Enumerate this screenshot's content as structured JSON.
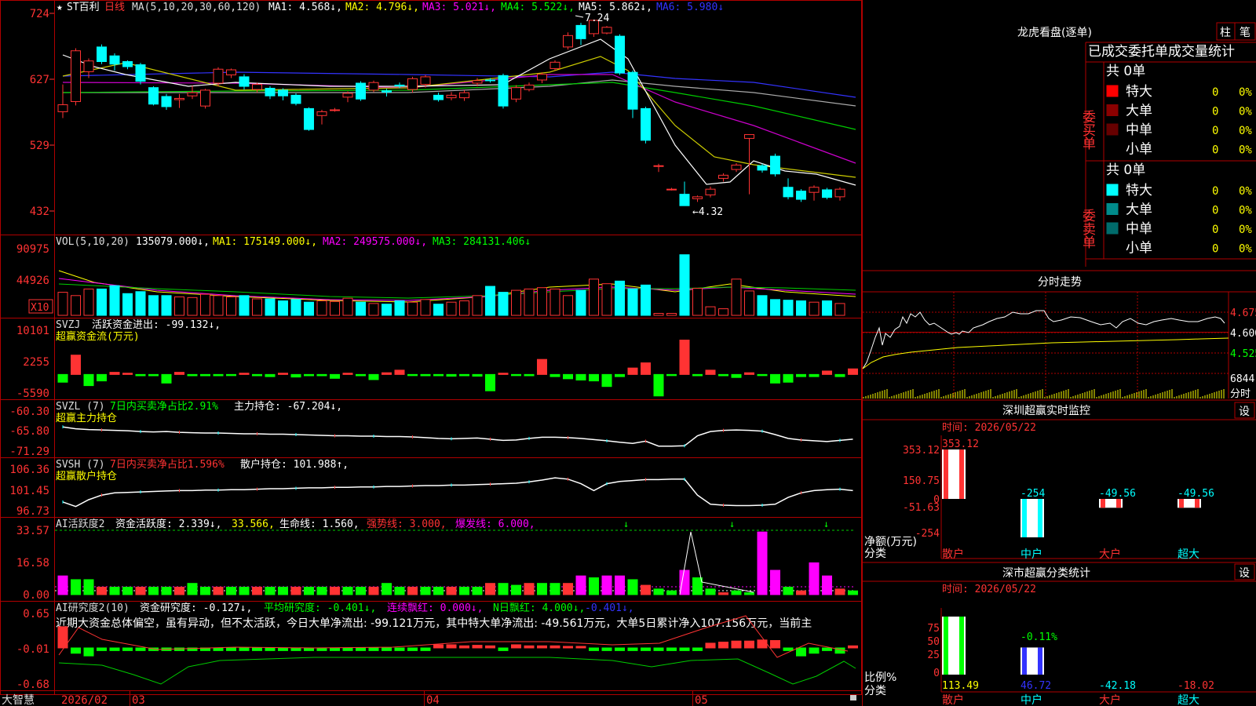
{
  "app": {
    "name": "大智慧"
  },
  "colors": {
    "red": "#ff3333",
    "cyan": "#00ffff",
    "magenta": "#ff00ff",
    "green": "#00ff00",
    "yellow": "#ffff00",
    "white": "#ffffff",
    "blue": "#3333ff",
    "dark_green": "#2e8b57",
    "frame": "#b00000"
  },
  "kline": {
    "header": {
      "star": "★",
      "stock": "ST百利",
      "period": "日线",
      "ma_label": "MA(5,10,20,30,60,120)",
      "items": [
        {
          "label": "MA1: 4.568↓,",
          "color": "white"
        },
        {
          "label": "MA2: 4.796↓,",
          "color": "yellow"
        },
        {
          "label": "MA3: 5.021↓,",
          "color": "magenta"
        },
        {
          "label": "MA4: 5.522↓,",
          "color": "green"
        },
        {
          "label": "MA5: 5.862↓,",
          "color": "white"
        },
        {
          "label": "MA6: 5.980↓",
          "color": "blue"
        }
      ]
    },
    "y_labels": [
      "724",
      "627",
      "529",
      "432"
    ],
    "high_annotation": "7.24",
    "low_annotation": "←4.32"
  },
  "chart_data": [
    {
      "type": "candlestick",
      "id": "price",
      "ylim": [
        4.1,
        7.35
      ],
      "x_labels": [
        "2026/02",
        "03",
        "04",
        "05"
      ],
      "candles": [
        [
          5.8,
          5.91,
          5.7,
          6.23
        ],
        [
          5.96,
          6.76,
          5.9,
          6.8
        ],
        [
          6.43,
          6.6,
          6.33,
          6.64
        ],
        [
          6.82,
          6.59,
          6.55,
          6.86
        ],
        [
          6.68,
          6.55,
          6.45,
          6.72
        ],
        [
          6.59,
          6.51,
          6.47,
          6.61
        ],
        [
          6.54,
          6.28,
          6.23,
          6.57
        ],
        [
          6.18,
          5.92,
          5.9,
          6.2
        ],
        [
          6.04,
          5.88,
          5.83,
          6.08
        ],
        [
          5.99,
          6.01,
          5.86,
          6.08
        ],
        [
          6.05,
          6.1,
          6.0,
          6.21
        ],
        [
          5.89,
          6.14,
          5.85,
          6.16
        ],
        [
          6.25,
          6.47,
          6.2,
          6.5
        ],
        [
          6.38,
          6.46,
          6.33,
          6.48
        ],
        [
          6.35,
          6.2,
          6.15,
          6.39
        ],
        [
          6.15,
          6.23,
          6.1,
          6.26
        ],
        [
          6.17,
          6.05,
          6.0,
          6.2
        ],
        [
          6.14,
          6.05,
          5.98,
          6.17
        ],
        [
          6.06,
          5.93,
          5.9,
          6.09
        ],
        [
          5.85,
          5.52,
          5.5,
          5.87
        ],
        [
          5.74,
          5.8,
          5.6,
          5.83
        ],
        [
          5.83,
          5.83,
          5.8,
          5.86
        ],
        [
          6.03,
          6.09,
          5.95,
          6.12
        ],
        [
          6.25,
          6.0,
          5.97,
          6.28
        ],
        [
          6.14,
          6.26,
          6.11,
          6.29
        ],
        [
          6.13,
          6.11,
          6.04,
          6.16
        ],
        [
          6.22,
          6.21,
          6.17,
          6.26
        ],
        [
          6.15,
          6.32,
          6.1,
          6.35
        ],
        [
          6.23,
          6.35,
          6.18,
          6.38
        ],
        [
          6.06,
          5.99,
          5.96,
          6.1
        ],
        [
          6.02,
          6.06,
          5.98,
          6.11
        ],
        [
          6.02,
          6.1,
          5.97,
          6.14
        ],
        [
          6.25,
          6.29,
          6.2,
          6.33
        ],
        [
          6.3,
          6.29,
          6.26,
          6.33
        ],
        [
          6.37,
          5.89,
          5.85,
          6.4
        ],
        [
          6.0,
          6.18,
          5.95,
          6.22
        ],
        [
          6.15,
          6.22,
          6.12,
          6.26
        ],
        [
          6.3,
          6.39,
          6.25,
          6.42
        ],
        [
          6.48,
          6.58,
          6.45,
          6.61
        ],
        [
          6.82,
          7.0,
          6.78,
          7.05
        ],
        [
          7.16,
          6.95,
          6.85,
          7.2
        ],
        [
          7.03,
          7.24,
          6.98,
          7.24
        ],
        [
          7.04,
          7.13,
          7.02,
          7.15
        ],
        [
          6.99,
          6.41,
          6.38,
          7.02
        ],
        [
          6.42,
          5.84,
          5.7,
          6.45
        ],
        [
          5.85,
          5.35,
          5.3,
          5.88
        ],
        [
          4.95,
          4.95,
          4.85,
          4.98
        ],
        [
          4.58,
          4.58,
          4.56,
          4.6
        ],
        [
          4.5,
          4.32,
          4.32,
          4.7
        ],
        [
          4.43,
          4.46,
          4.38,
          4.48
        ],
        [
          4.49,
          4.58,
          4.45,
          4.62
        ],
        [
          4.75,
          4.8,
          4.7,
          4.83
        ],
        [
          4.89,
          4.96,
          4.85,
          4.99
        ],
        [
          5.38,
          5.44,
          4.5,
          5.44
        ],
        [
          4.95,
          4.88,
          4.84,
          4.98
        ],
        [
          5.1,
          4.82,
          4.78,
          5.14
        ],
        [
          4.61,
          4.46,
          4.42,
          4.75
        ],
        [
          4.55,
          4.42,
          4.38,
          4.58
        ],
        [
          4.53,
          4.61,
          4.4,
          4.64
        ],
        [
          4.57,
          4.45,
          4.42,
          4.6
        ],
        [
          4.46,
          4.58,
          4.4,
          4.61
        ]
      ]
    },
    {
      "type": "bar",
      "id": "volume",
      "ylim": [
        0,
        100000
      ],
      "y_labels": [
        "90975",
        "44926"
      ],
      "unit_badge": "X10",
      "header": {
        "label": "VOL(5,10,20)",
        "value": "135079.000↓,",
        "ma1": "MA1: 175149.000↓,",
        "ma2": "MA2: 249575.000↓,",
        "ma3": "MA3: 284131.406↓"
      },
      "values": [
        35000,
        30000,
        40000,
        40000,
        45000,
        33000,
        36000,
        30000,
        30000,
        28000,
        27000,
        32000,
        30000,
        28000,
        30000,
        25000,
        25000,
        22000,
        24000,
        20000,
        22000,
        21000,
        26000,
        20000,
        18000,
        17000,
        22000,
        20000,
        24000,
        17000,
        20000,
        22000,
        30000,
        44000,
        35000,
        38000,
        40000,
        42000,
        40000,
        30000,
        38000,
        55000,
        48000,
        52000,
        40000,
        46000,
        3000,
        3000,
        92000,
        41000,
        13000,
        10000,
        55000,
        37000,
        30000,
        24000,
        23000,
        22000,
        20000,
        22000,
        18000
      ]
    },
    {
      "type": "bar",
      "id": "svzj",
      "ylim": [
        -5590,
        10101
      ],
      "y_labels": [
        "10101",
        "2255",
        "-5590"
      ],
      "header": {
        "label": "SVZJ",
        "text": "活跃资金进出: -99.132↓,",
        "title": "超赢资金流(万元)"
      },
      "values": [
        -1800,
        4500,
        -2600,
        -1500,
        500,
        300,
        -300,
        -300,
        -2000,
        500,
        -300,
        -300,
        -300,
        -200,
        300,
        -300,
        -500,
        300,
        -600,
        -300,
        -300,
        -900,
        300,
        -300,
        -1200,
        400,
        1000,
        -200,
        -300,
        -300,
        -400,
        -300,
        -400,
        -3800,
        300,
        -200,
        -300,
        3500,
        -500,
        -1000,
        -1300,
        -1500,
        -2800,
        -500,
        1500,
        2700,
        -5000,
        -50,
        8000,
        -300,
        1000,
        -300,
        -700,
        400,
        -200,
        -2000,
        -1800,
        -500,
        -500,
        800,
        -500,
        1300
      ]
    },
    {
      "type": "line",
      "id": "svzl",
      "ylim": [
        -71.29,
        -60.3
      ],
      "y_labels": [
        "-60.30",
        "-65.80",
        "-71.29"
      ],
      "header": {
        "label": "SVZL (7)",
        "green_text": "7日内买卖净占比2.91%",
        "text": "主力持仓: -67.204↓,",
        "title": "超赢主力持仓"
      },
      "values": [
        -64.0,
        -64.5,
        -64.7,
        -64.8,
        -64.9,
        -65.0,
        -65.2,
        -65.3,
        -65.2,
        -65.4,
        -65.5,
        -65.6,
        -65.6,
        -65.7,
        -65.8,
        -65.8,
        -65.9,
        -65.9,
        -66.0,
        -66.1,
        -66.2,
        -66.3,
        -66.3,
        -66.4,
        -66.4,
        -66.5,
        -66.5,
        -66.6,
        -66.8,
        -67.0,
        -67.1,
        -67.0,
        -66.9,
        -67.2,
        -67.5,
        -67.4,
        -67.0,
        -66.7,
        -66.7,
        -66.8,
        -67.0,
        -67.3,
        -67.6,
        -68.0,
        -68.3,
        -67.7,
        -69.0,
        -69.0,
        -68.9,
        -66.3,
        -65.2,
        -64.9,
        -64.8,
        -64.9,
        -65.1,
        -66.0,
        -67.0,
        -67.4,
        -67.6,
        -67.8,
        -67.5,
        -67.2
      ]
    },
    {
      "type": "line",
      "id": "svsh",
      "ylim": [
        96.73,
        106.36
      ],
      "y_labels": [
        "106.36",
        "101.45",
        "96.73"
      ],
      "header": {
        "label": "SVSH (7)",
        "red_text": "7日内买卖净占比1.596%",
        "text": "散户持仓: 101.988↑,",
        "title": "超赢散户持仓"
      },
      "values": [
        99.5,
        98.5,
        100.0,
        101.0,
        101.5,
        101.6,
        101.7,
        101.8,
        101.9,
        102.0,
        102.0,
        102.1,
        102.1,
        102.2,
        102.2,
        102.3,
        102.4,
        102.4,
        102.5,
        102.6,
        102.6,
        102.7,
        102.7,
        102.8,
        102.8,
        102.9,
        102.9,
        103.0,
        103.1,
        103.1,
        103.2,
        103.2,
        103.3,
        103.4,
        103.5,
        103.6,
        103.9,
        104.3,
        104.8,
        104.5,
        103.5,
        102.0,
        103.5,
        104.0,
        104.2,
        104.4,
        104.4,
        104.5,
        104.5,
        101.0,
        99.0,
        98.8,
        98.7,
        98.7,
        98.8,
        99.0,
        100.5,
        101.5,
        102.0,
        102.2,
        102.3,
        102.0
      ]
    },
    {
      "type": "bar",
      "id": "ai_activity",
      "ylim": [
        0,
        33.57
      ],
      "y_labels": [
        "33.57",
        "16.58",
        "0.00"
      ],
      "header": {
        "label": "AI活跃度2",
        "text": "资金活跃度: 2.339↓,",
        "yellow_text": "33.566,",
        "text2": "生命线: 1.560,",
        "red_text": "强势线: 3.000,",
        "magenta_text": "爆发线: 6.000,"
      },
      "values": [
        10,
        8,
        8,
        4,
        4,
        4,
        4,
        4,
        4,
        4,
        6,
        4,
        4,
        4,
        4,
        4,
        4,
        4,
        4,
        4,
        4,
        4,
        4,
        4,
        4,
        6,
        4,
        4,
        4,
        4,
        4,
        4,
        4,
        6,
        6,
        5,
        6,
        6,
        6,
        6,
        10,
        9,
        10,
        10,
        8,
        5,
        3,
        2,
        13,
        9,
        3,
        1,
        2,
        1,
        33.5,
        13,
        4,
        2,
        17,
        10,
        3,
        2
      ]
    },
    {
      "type": "bar",
      "id": "ai_research",
      "ylim": [
        -0.68,
        0.65
      ],
      "y_labels": [
        "0.65",
        "-0.01",
        "-0.68"
      ],
      "header": {
        "label": "AI研究度2(10)",
        "text": "资金研究度: -0.127↓,",
        "green_text": "平均研究度: -0.401↓,",
        "magenta_text": "连续飘红: 0.000↓,",
        "green_text2": "N日飘红: 4.000↓,",
        "blue_text": "-0.401↓,"
      },
      "commentary": "近期大资金总体偏空，虽有异动，但不太活跃，今日大单净流出: -99.121万元，其中特大单净流出: -49.561万元，大单5日累计净入107.156万元，当前主",
      "values": [
        0.4,
        -0.1,
        -0.15,
        -0.05,
        -0.05,
        -0.05,
        -0.05,
        -0.05,
        -0.05,
        -0.05,
        -0.05,
        -0.05,
        -0.05,
        -0.05,
        -0.05,
        -0.05,
        -0.05,
        -0.05,
        -0.05,
        -0.05,
        -0.05,
        -0.05,
        -0.05,
        -0.05,
        -0.05,
        -0.05,
        -0.05,
        -0.05,
        -0.05,
        0.06,
        0.06,
        0.04,
        0.05,
        0.04,
        -0.05,
        0.06,
        0.04,
        0.04,
        0.04,
        0.03,
        0.03,
        -0.05,
        -0.05,
        -0.05,
        -0.05,
        -0.05,
        -0.05,
        -0.05,
        -0.05,
        -0.05,
        0.09,
        0.11,
        0.13,
        0.13,
        0.15,
        0.14,
        -0.05,
        -0.15,
        -0.1,
        -0.05,
        -0.1,
        0.04
      ]
    }
  ],
  "right_panel": {
    "top_tabs": [
      "柱",
      "笔"
    ],
    "lhb": {
      "title": "龙虎看盘(逐单)",
      "subtitle": "已成交委托单成交量统计",
      "buy_label": "委买单",
      "sell_label": "委卖单",
      "buy_total": "共 0单",
      "sell_total": "共 0单",
      "buy_rows": [
        {
          "label": "特大",
          "value": "0",
          "pct": "0%",
          "color": "#ff0000"
        },
        {
          "label": "大单",
          "value": "0",
          "pct": "0%",
          "color": "#8b0000"
        },
        {
          "label": "中单",
          "value": "0",
          "pct": "0%",
          "color": "#660000"
        },
        {
          "label": "小单",
          "value": "0",
          "pct": "0%",
          "color": "#000000"
        }
      ],
      "sell_rows": [
        {
          "label": "特大",
          "value": "0",
          "pct": "0%",
          "color": "#00ffff"
        },
        {
          "label": "大单",
          "value": "0",
          "pct": "0%",
          "color": "#008b8b"
        },
        {
          "label": "中单",
          "value": "0",
          "pct": "0%",
          "color": "#006b6b"
        },
        {
          "label": "小单",
          "value": "0",
          "pct": "0%",
          "color": "#000000"
        }
      ]
    },
    "intraday": {
      "title": "分时走势",
      "price_labels": [
        "4.675",
        "4.600",
        "4.525"
      ],
      "volume_label": "6844",
      "volume_sublabel": "分时"
    },
    "realtime_monitor": {
      "title": "深圳超赢实时监控",
      "settings": "设",
      "date_label": "时间: 2026/05/22",
      "y_labels": [
        "353.12",
        "150.75",
        "0",
        "-51.63",
        "-254"
      ],
      "net_label": "净额(万元)",
      "category_label": "分类",
      "chart_data": {
        "type": "bar",
        "ylim": [
          -254,
          353.12
        ],
        "categories": [
          "散户",
          "中户",
          "大户",
          "超大"
        ],
        "values": [
          353.12,
          -254,
          -49.56,
          -49.56
        ],
        "value_labels": [
          "353.12",
          "-254",
          "-49.56",
          "-49.56"
        ]
      }
    },
    "classification": {
      "title": "深市超赢分类统计",
      "settings": "设",
      "date_label": "时间: 2026/05/22",
      "y_labels": [
        "75",
        "50",
        "25",
        "0"
      ],
      "ratio_label": "比例%",
      "category_label": "分类",
      "chart_data": {
        "type": "bar",
        "ylim": [
          0,
          100
        ],
        "categories": [
          "散户",
          "中户",
          "大户",
          "超大"
        ],
        "values": [
          113.49,
          46.72,
          -42.18,
          -18.02
        ],
        "bar_label": "-0.11%",
        "value_labels": [
          "113.49",
          "46.72",
          "-42.18",
          "-18.02"
        ]
      }
    }
  }
}
